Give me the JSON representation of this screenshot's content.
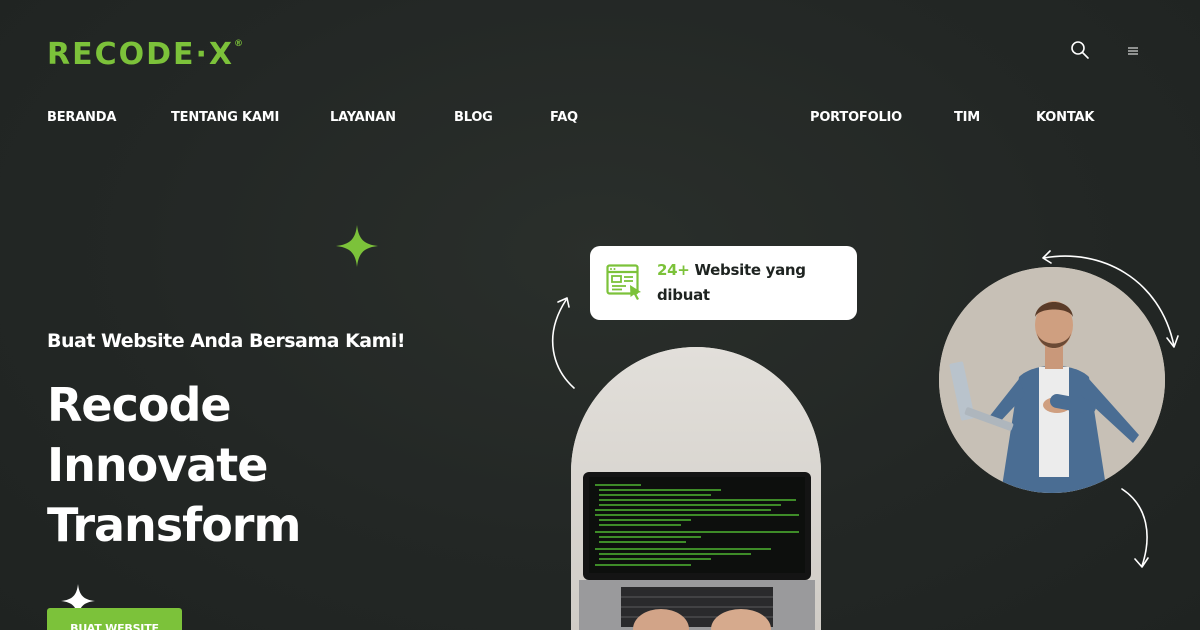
{
  "header": {
    "logo_text": "RECODE·X",
    "logo_mark": "®",
    "search_icon": "search-icon",
    "menu_icon": "hamburger-menu-icon"
  },
  "nav": {
    "items": [
      {
        "label": "BERANDA"
      },
      {
        "label": "TENTANG KAMI"
      },
      {
        "label": "LAYANAN"
      },
      {
        "label": "BLOG"
      },
      {
        "label": "FAQ"
      },
      {
        "label": "PORTOFOLIO"
      },
      {
        "label": "TIM"
      },
      {
        "label": "KONTAK"
      }
    ]
  },
  "hero": {
    "tagline": "Buat Website Anda Bersama Kami!",
    "headline_lines": [
      "Recode",
      "Innovate",
      "Transform"
    ],
    "cta_label": "BUAT WEBSITE"
  },
  "stat_card": {
    "number": "24+",
    "text_line1": " Website yang",
    "text_line2": "dibuat",
    "icon": "website-click-icon"
  },
  "colors": {
    "accent": "#7cc23a",
    "background": "#232725",
    "text": "#ffffff"
  }
}
